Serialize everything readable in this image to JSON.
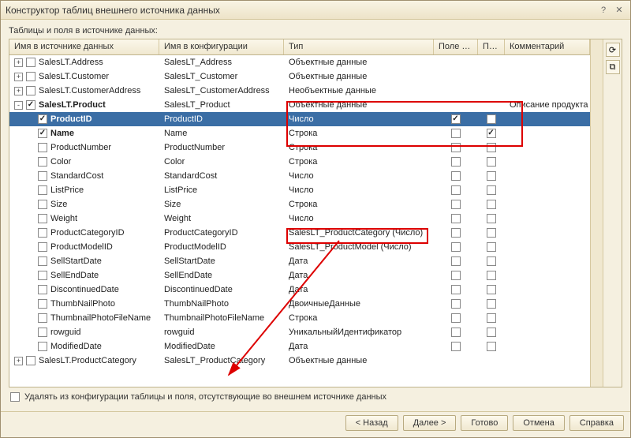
{
  "title": "Конструктор таблиц внешнего источника данных",
  "subtitle": "Таблицы и поля в источнике данных:",
  "columns": {
    "c1": "Имя в источнике данных",
    "c2": "Имя в конфигурации",
    "c3": "Тип",
    "c4": "Поле кл...",
    "c5": "По...",
    "c6": "Комментарий"
  },
  "rows": [
    {
      "level": 1,
      "toggle": "+",
      "checked": false,
      "src": "SalesLT.Address",
      "cfg": "SalesLT_Address",
      "type": "Объектные данные",
      "keyChk": null,
      "presChk": null,
      "comment": ""
    },
    {
      "level": 1,
      "toggle": "+",
      "checked": false,
      "src": "SalesLT.Customer",
      "cfg": "SalesLT_Customer",
      "type": "Объектные данные",
      "keyChk": null,
      "presChk": null,
      "comment": ""
    },
    {
      "level": 1,
      "toggle": "+",
      "checked": false,
      "src": "SalesLT.CustomerAddress",
      "cfg": "SalesLT_CustomerAddress",
      "type": "Необъектные данные",
      "keyChk": null,
      "presChk": null,
      "comment": ""
    },
    {
      "level": 1,
      "toggle": "-",
      "checked": true,
      "bold": true,
      "src": "SalesLT.Product",
      "cfg": "SalesLT_Product",
      "type": "Объектные данные",
      "keyChk": null,
      "presChk": null,
      "comment": "Описание продукта"
    },
    {
      "level": 2,
      "checked": true,
      "bold": true,
      "src": "ProductID",
      "cfg": "ProductID",
      "type": "Число",
      "keyChk": true,
      "presChk": false,
      "comment": "",
      "selected": true
    },
    {
      "level": 2,
      "checked": true,
      "bold": true,
      "src": "Name",
      "cfg": "Name",
      "type": "Строка",
      "keyChk": false,
      "presChk": true,
      "comment": ""
    },
    {
      "level": 2,
      "checked": false,
      "src": "ProductNumber",
      "cfg": "ProductNumber",
      "type": "Строка",
      "keyChk": false,
      "presChk": false,
      "comment": ""
    },
    {
      "level": 2,
      "checked": false,
      "src": "Color",
      "cfg": "Color",
      "type": "Строка",
      "keyChk": false,
      "presChk": false,
      "comment": ""
    },
    {
      "level": 2,
      "checked": false,
      "src": "StandardCost",
      "cfg": "StandardCost",
      "type": "Число",
      "keyChk": false,
      "presChk": false,
      "comment": ""
    },
    {
      "level": 2,
      "checked": false,
      "src": "ListPrice",
      "cfg": "ListPrice",
      "type": "Число",
      "keyChk": false,
      "presChk": false,
      "comment": ""
    },
    {
      "level": 2,
      "checked": false,
      "src": "Size",
      "cfg": "Size",
      "type": "Строка",
      "keyChk": false,
      "presChk": false,
      "comment": ""
    },
    {
      "level": 2,
      "checked": false,
      "src": "Weight",
      "cfg": "Weight",
      "type": "Число",
      "keyChk": false,
      "presChk": false,
      "comment": ""
    },
    {
      "level": 2,
      "checked": false,
      "src": "ProductCategoryID",
      "cfg": "ProductCategoryID",
      "type": "SalesLT_ProductCategory (Число)",
      "keyChk": false,
      "presChk": false,
      "comment": ""
    },
    {
      "level": 2,
      "checked": false,
      "src": "ProductModelID",
      "cfg": "ProductModelID",
      "type": "SalesLT_ProductModel (Число)",
      "keyChk": false,
      "presChk": false,
      "comment": ""
    },
    {
      "level": 2,
      "checked": false,
      "src": "SellStartDate",
      "cfg": "SellStartDate",
      "type": "Дата",
      "keyChk": false,
      "presChk": false,
      "comment": ""
    },
    {
      "level": 2,
      "checked": false,
      "src": "SellEndDate",
      "cfg": "SellEndDate",
      "type": "Дата",
      "keyChk": false,
      "presChk": false,
      "comment": ""
    },
    {
      "level": 2,
      "checked": false,
      "src": "DiscontinuedDate",
      "cfg": "DiscontinuedDate",
      "type": "Дата",
      "keyChk": false,
      "presChk": false,
      "comment": ""
    },
    {
      "level": 2,
      "checked": false,
      "src": "ThumbNailPhoto",
      "cfg": "ThumbNailPhoto",
      "type": "ДвоичныеДанные",
      "keyChk": false,
      "presChk": false,
      "comment": ""
    },
    {
      "level": 2,
      "checked": false,
      "src": "ThumbnailPhotoFileName",
      "cfg": "ThumbnailPhotoFileName",
      "type": "Строка",
      "keyChk": false,
      "presChk": false,
      "comment": ""
    },
    {
      "level": 2,
      "checked": false,
      "src": "rowguid",
      "cfg": "rowguid",
      "type": "УникальныйИдентификатор",
      "keyChk": false,
      "presChk": false,
      "comment": ""
    },
    {
      "level": 2,
      "checked": false,
      "src": "ModifiedDate",
      "cfg": "ModifiedDate",
      "type": "Дата",
      "keyChk": false,
      "presChk": false,
      "comment": ""
    },
    {
      "level": 1,
      "toggle": "+",
      "checked": false,
      "src": "SalesLT.ProductCategory",
      "cfg": "SalesLT_ProductCategory",
      "type": "Объектные данные",
      "keyChk": null,
      "presChk": null,
      "comment": ""
    }
  ],
  "footerCheck": "Удалять из конфигурации таблицы и поля, отсутствующие во внешнем источнике данных",
  "buttons": {
    "back": "< Назад",
    "next": "Далее >",
    "finish": "Готово",
    "cancel": "Отмена",
    "help": "Справка"
  }
}
